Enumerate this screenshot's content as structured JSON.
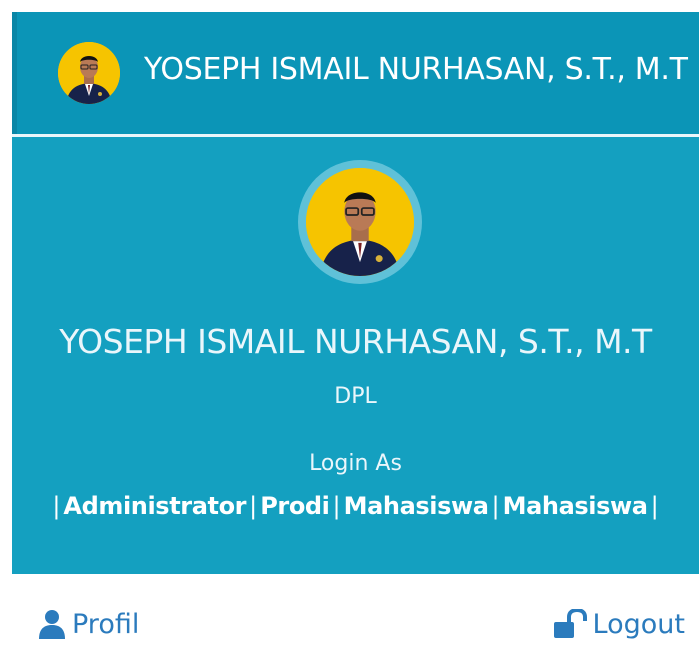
{
  "header": {
    "user_name": "YOSEPH ISMAIL NURHASAN, S.T., M.T",
    "avatar_icon": "user-photo-icon"
  },
  "user_panel": {
    "name": "YOSEPH ISMAIL NURHASAN, S.T., M.T",
    "role": "DPL",
    "login_as_label": "Login As",
    "separator": "|",
    "login_links": [
      "Administrator",
      "Prodi",
      "Mahasiswa",
      "Mahasiswa"
    ]
  },
  "footer": {
    "profil_label": "Profil",
    "profil_icon": "user-icon",
    "logout_label": "Logout",
    "logout_icon": "unlock-icon"
  },
  "colors": {
    "topbar": "#0b95b7",
    "panel": "#14a0c0",
    "link": "#2b7bbd"
  }
}
